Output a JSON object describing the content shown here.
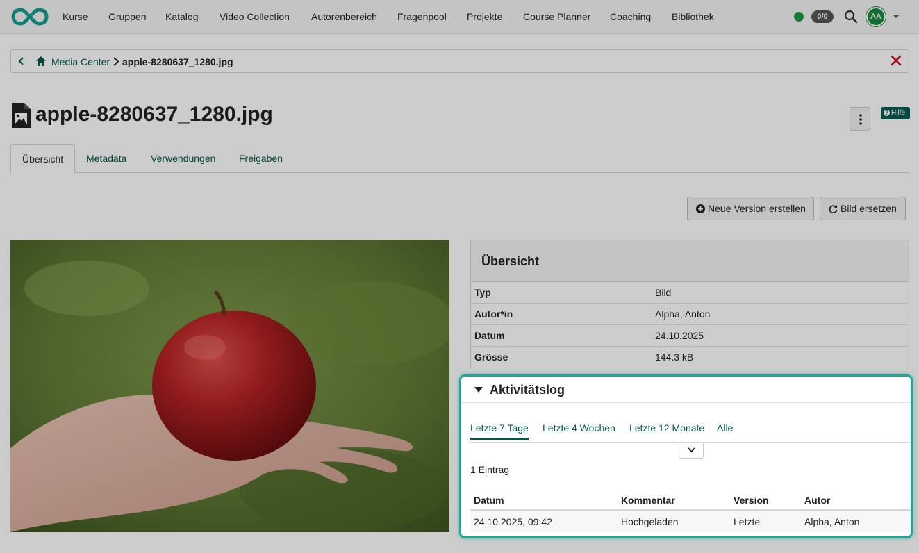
{
  "nav": {
    "items": [
      "Kurse",
      "Gruppen",
      "Katalog",
      "Video Collection",
      "Autorenbereich",
      "Fragenpool",
      "Projekte",
      "Course Planner",
      "Coaching",
      "Bibliothek"
    ],
    "counter": "0/0",
    "avatar_initials": "AA",
    "icons": {
      "logo": "infinity-logo",
      "search": "search-icon",
      "caret": "chevron-down-icon"
    },
    "status_color": "#1a9b46"
  },
  "breadcrumb": {
    "root": "Media Center",
    "current": "apple-8280637_1280.jpg",
    "icons": {
      "back": "chevron-left-icon",
      "home": "home-icon",
      "separator": "chevron-right-icon",
      "close": "close-icon"
    }
  },
  "page": {
    "title": "apple-8280637_1280.jpg",
    "help_label": "Hilfe",
    "file_icon": "image-file-icon"
  },
  "tabs": [
    {
      "label": "Übersicht",
      "active": true
    },
    {
      "label": "Metadata",
      "active": false
    },
    {
      "label": "Verwendungen",
      "active": false
    },
    {
      "label": "Freigaben",
      "active": false
    }
  ],
  "actions": {
    "new_version": "Neue Version erstellen",
    "replace_image": "Bild ersetzen"
  },
  "overview": {
    "title": "Übersicht",
    "rows": [
      {
        "label": "Typ",
        "value": "Bild"
      },
      {
        "label": "Autor*in",
        "value": "Alpha, Anton"
      },
      {
        "label": "Datum",
        "value": "24.10.2025"
      },
      {
        "label": "Grösse",
        "value": "144.3 kB"
      }
    ]
  },
  "activity": {
    "title": "Aktivitätslog",
    "tabs": [
      {
        "label": "Letzte 7 Tage",
        "active": true
      },
      {
        "label": "Letzte 4 Wochen",
        "active": false
      },
      {
        "label": "Letzte 12 Monate",
        "active": false
      },
      {
        "label": "Alle",
        "active": false
      }
    ],
    "count": "1 Eintrag",
    "columns": [
      "Datum",
      "Kommentar",
      "Version",
      "Autor"
    ],
    "rows": [
      [
        "24.10.2025, 09:42",
        "Hochgeladen",
        "Letzte",
        "Alpha, Anton"
      ]
    ]
  },
  "colors": {
    "accent": "#00574b",
    "highlight": "#1ea59a",
    "danger": "#d0021b"
  }
}
